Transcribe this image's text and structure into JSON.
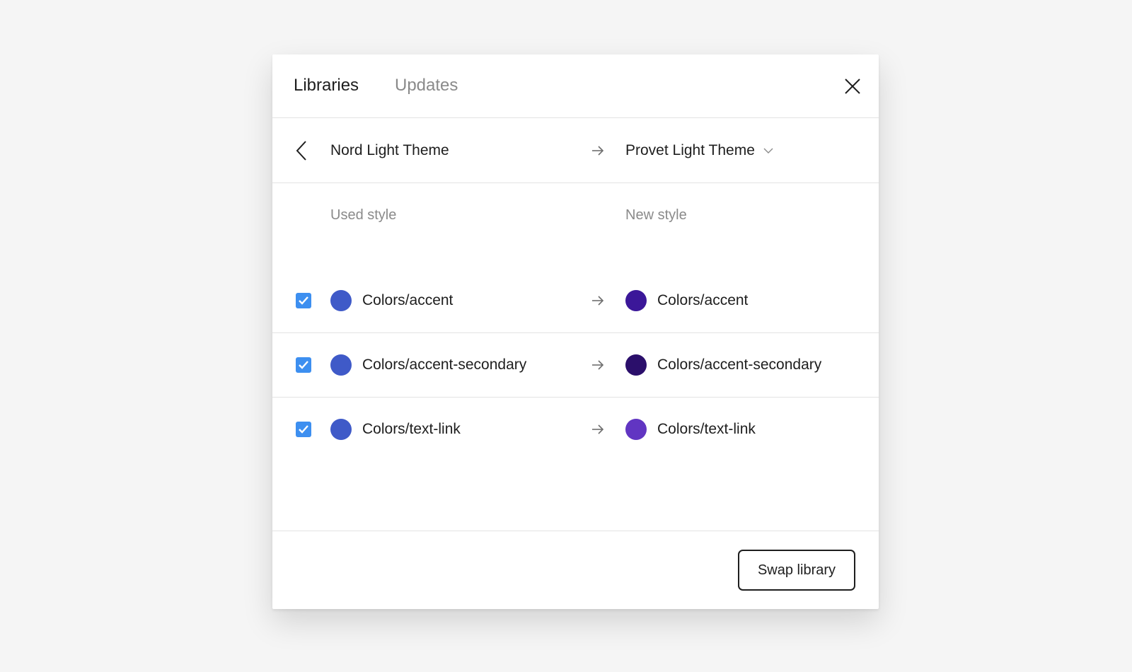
{
  "header": {
    "tabs": [
      {
        "label": "Libraries",
        "active": true
      },
      {
        "label": "Updates",
        "active": false
      }
    ],
    "close_icon": "close-icon"
  },
  "library_swap": {
    "back_icon": "chevron-left-icon",
    "from": "Nord Light Theme",
    "to": "Provet Light Theme",
    "dropdown_icon": "chevron-down-icon"
  },
  "columns": {
    "used": "Used style",
    "new": "New style"
  },
  "styles": [
    {
      "checked": true,
      "old_name": "Colors/accent",
      "old_color": "#3f5ac8",
      "new_name": "Colors/accent",
      "new_color": "#3b1799"
    },
    {
      "checked": true,
      "old_name": "Colors/accent-secondary",
      "old_color": "#3f5ac8",
      "new_name": "Colors/accent-secondary",
      "new_color": "#2b0f6b"
    },
    {
      "checked": true,
      "old_name": "Colors/text-link",
      "old_color": "#3f5ac8",
      "new_name": "Colors/text-link",
      "new_color": "#6135c2"
    }
  ],
  "footer": {
    "swap_button": "Swap library"
  },
  "colors": {
    "checkbox": "#3d8ff0",
    "text": "#1e1e1e",
    "muted": "#8a8a8a",
    "divider": "#e3e3e3"
  }
}
